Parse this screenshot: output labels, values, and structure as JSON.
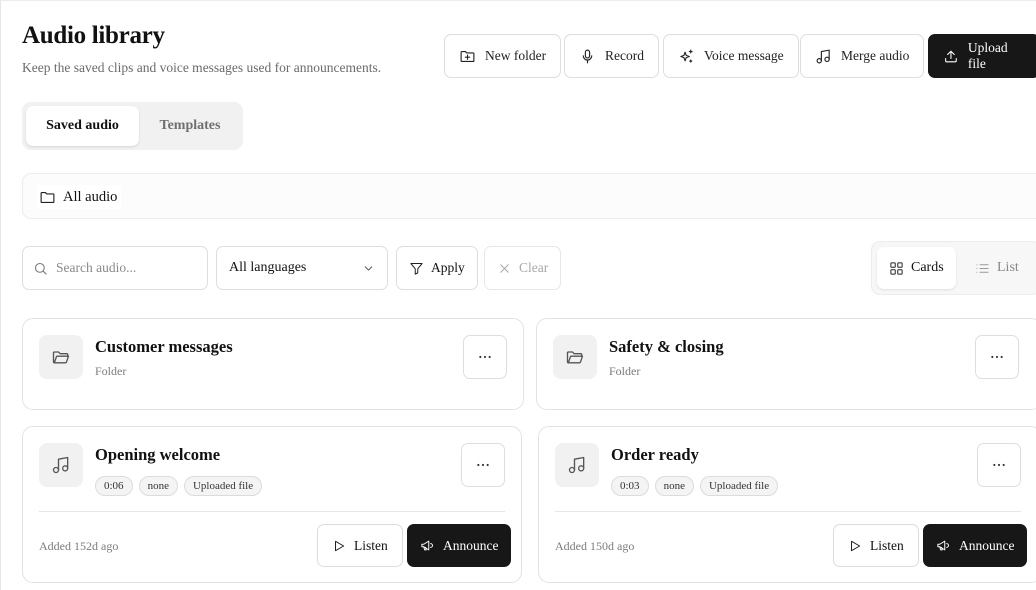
{
  "header": {
    "title": "Audio library",
    "subtitle": "Keep the saved clips and voice messages used for announcements."
  },
  "toolbar": {
    "new_folder": "New folder",
    "record": "Record",
    "voice_message": "Voice message",
    "merge_audio": "Merge audio",
    "upload_file": "Upload file"
  },
  "tabs": {
    "saved_audio": "Saved audio",
    "templates": "Templates",
    "active": "Saved audio"
  },
  "breadcrumb": {
    "root": "All audio"
  },
  "filters": {
    "search_placeholder": "Search audio...",
    "search_value": "",
    "language": "All languages",
    "apply": "Apply",
    "clear": "Clear"
  },
  "view": {
    "cards": "Cards",
    "list": "List",
    "active": "Cards"
  },
  "folders": [
    {
      "name": "Customer messages",
      "type": "Folder"
    },
    {
      "name": "Safety & closing",
      "type": "Folder"
    }
  ],
  "clips": [
    {
      "name": "Opening welcome",
      "duration": "0:06",
      "language": "none",
      "source": "Uploaded file",
      "added": "Added 152d ago",
      "listen": "Listen",
      "announce": "Announce"
    },
    {
      "name": "Order ready",
      "duration": "0:03",
      "language": "none",
      "source": "Uploaded file",
      "added": "Added 150d ago",
      "listen": "Listen",
      "announce": "Announce"
    }
  ],
  "colors": {
    "primary_dark": "#171717",
    "border": "#dedede",
    "muted_text": "#6b6b6b"
  },
  "icons": [
    "folder-plus-icon",
    "microphone-icon",
    "sparkles-icon",
    "music-note-icon",
    "upload-icon",
    "folder-icon",
    "search-icon",
    "chevron-down-icon",
    "filter-icon",
    "x-icon",
    "grid-icon",
    "list-icon",
    "folder-open-icon",
    "more-horizontal-icon",
    "play-icon",
    "megaphone-icon"
  ]
}
